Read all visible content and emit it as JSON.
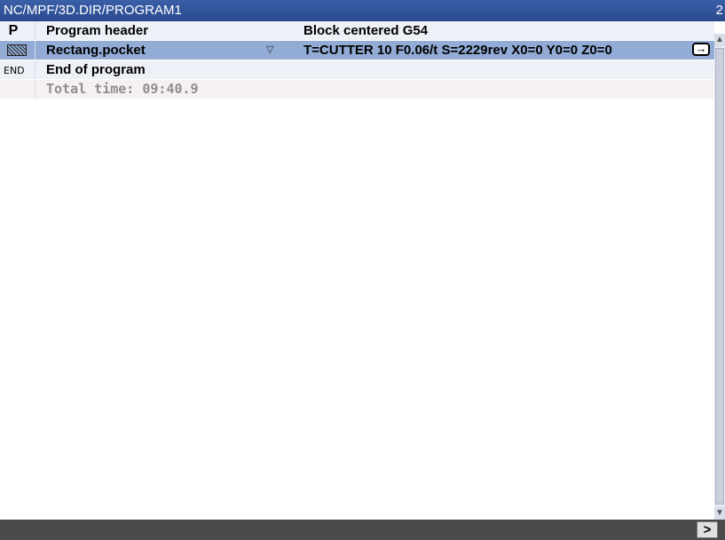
{
  "window": {
    "path": "NC/MPF/3D.DIR/PROGRAM1",
    "number": "2"
  },
  "rows": [
    {
      "icon": "P",
      "name": "Program header",
      "desc": "Block centered G54"
    },
    {
      "icon": "rect-pocket-icon",
      "name": "Rectang.pocket",
      "desc": "T=CUTTER 10 F0.06/t S=2229rev X0=0 Y0=0 Z0=0",
      "dropdown": "▽"
    },
    {
      "icon": "END",
      "name": "End of program",
      "desc": ""
    },
    {
      "icon": "",
      "name": "Total time:  09:40.9",
      "desc": ""
    }
  ],
  "bottombar": {
    "more_label": ">"
  },
  "colors": {
    "titlebar": "#2f54a0",
    "selected_row": "#92acd6",
    "bottombar": "#4a4a4a"
  }
}
